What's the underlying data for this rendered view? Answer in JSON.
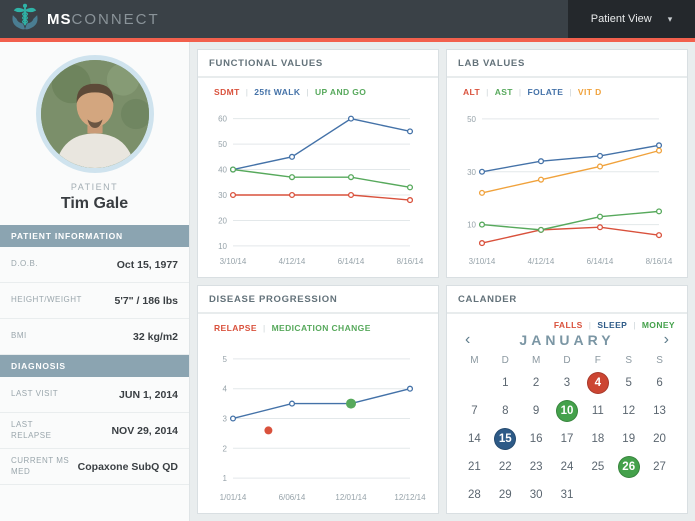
{
  "header": {
    "brand_bold": "MS",
    "brand_light": "CONNECT",
    "patient_view": {
      "label": "Patient View",
      "caret_glyph": "▾"
    },
    "colors": {
      "bar": "#3a4147",
      "accent": "#f2604d",
      "patient_view_bg": "#24282c",
      "logo_teal": "#2fb3a7"
    }
  },
  "sidebar": {
    "patient_label": "PATIENT",
    "patient_name": "Tim Gale",
    "sections": [
      {
        "title": "PATIENT INFORMATION",
        "rows": [
          {
            "label": "D.O.B.",
            "value": "Oct 15, 1977"
          },
          {
            "label": "HEIGHT/WEIGHT",
            "value": "5'7\" / 186 lbs"
          },
          {
            "label": "BMI",
            "value": "32 kg/m2"
          }
        ]
      },
      {
        "title": "DIAGNOSIS",
        "rows": [
          {
            "label": "LAST VISIT",
            "value": "JUN 1, 2014"
          },
          {
            "label": "LAST RELAPSE",
            "value": "NOV 29, 2014"
          },
          {
            "label": "CURRENT MS MED",
            "value": "Copaxone SubQ QD"
          }
        ]
      }
    ]
  },
  "chart_data": [
    {
      "type": "line",
      "title": "FUNCTIONAL VALUES",
      "x_labels": [
        "3/10/14",
        "4/12/14",
        "6/14/14",
        "8/16/14"
      ],
      "y_ticks": [
        10,
        20,
        30,
        40,
        50,
        60
      ],
      "y_range": [
        8,
        63
      ],
      "grid": true,
      "legend_position": "top",
      "legend": [
        {
          "label": "SDMT",
          "color": "#d9513c"
        },
        {
          "label": "25ft WALK",
          "color": "#4472a8"
        },
        {
          "label": "UP AND GO",
          "color": "#57a95c"
        }
      ],
      "series": [
        {
          "name": "SDMT",
          "color": "#d9513c",
          "values": [
            30,
            30,
            30,
            28
          ]
        },
        {
          "name": "25ft WALK",
          "color": "#4472a8",
          "values": [
            40,
            45,
            60,
            55
          ]
        },
        {
          "name": "UP AND GO",
          "color": "#57a95c",
          "values": [
            40,
            37,
            37,
            33
          ]
        }
      ]
    },
    {
      "type": "line",
      "title": "LAB VALUES",
      "x_labels": [
        "3/10/14",
        "4/12/14",
        "6/14/14",
        "8/16/14"
      ],
      "y_ticks": [
        10,
        30,
        50
      ],
      "y_range": [
        0,
        53
      ],
      "grid": true,
      "legend_position": "top",
      "legend": [
        {
          "label": "ALT",
          "color": "#d9513c"
        },
        {
          "label": "AST",
          "color": "#57a95c"
        },
        {
          "label": "FOLATE",
          "color": "#4472a8"
        },
        {
          "label": "VIT D",
          "color": "#f0a23c"
        }
      ],
      "series": [
        {
          "name": "ALT",
          "color": "#d9513c",
          "values": [
            3,
            8,
            9,
            6
          ]
        },
        {
          "name": "AST",
          "color": "#57a95c",
          "values": [
            10,
            8,
            13,
            15
          ]
        },
        {
          "name": "FOLATE",
          "color": "#4472a8",
          "values": [
            30,
            34,
            36,
            40
          ]
        },
        {
          "name": "VIT D",
          "color": "#f0a23c",
          "values": [
            22,
            27,
            32,
            38
          ]
        }
      ]
    },
    {
      "type": "line",
      "title": "DISEASE PROGRESSION",
      "x_labels": [
        "1/01/14",
        "6/06/14",
        "12/01/14",
        "12/12/14"
      ],
      "y_ticks": [
        1,
        2,
        3,
        4,
        5
      ],
      "y_range": [
        0.7,
        5.4
      ],
      "grid": true,
      "legend_position": "top",
      "legend": [
        {
          "label": "RELAPSE",
          "color": "#d9513c"
        },
        {
          "label": "MEDICATION CHANGE",
          "color": "#57a95c"
        }
      ],
      "series": [
        {
          "name": "progression",
          "color": "#4472a8",
          "values": [
            3,
            3.5,
            3.5,
            4
          ]
        }
      ],
      "markers": [
        {
          "label": "RELAPSE",
          "x": 0.6,
          "y": 2.6,
          "color": "#d9513c",
          "r": 4
        },
        {
          "label": "MEDICATION CHANGE",
          "x": 2,
          "y": 3.5,
          "color": "#57a95c",
          "r": 5
        }
      ]
    }
  ],
  "calendar": {
    "title": "CALANDER",
    "legend": [
      {
        "label": "FALLS",
        "color": "#d9513c"
      },
      {
        "label": "SLEEP",
        "color": "#2d5a87"
      },
      {
        "label": "MONEY",
        "color": "#44a14b"
      }
    ],
    "month": "JANUARY",
    "prev_symbol": "‹",
    "next_symbol": "›",
    "weekdays": [
      "M",
      "D",
      "M",
      "D",
      "F",
      "S",
      "S"
    ],
    "first_day_offset": 1,
    "days_in_month": 31,
    "events": {
      "4": "falls",
      "10": "money",
      "15": "sleep",
      "26": "money"
    },
    "event_colors": {
      "falls": "#cc4532",
      "sleep": "#2d5a87",
      "money": "#44a14b"
    }
  }
}
